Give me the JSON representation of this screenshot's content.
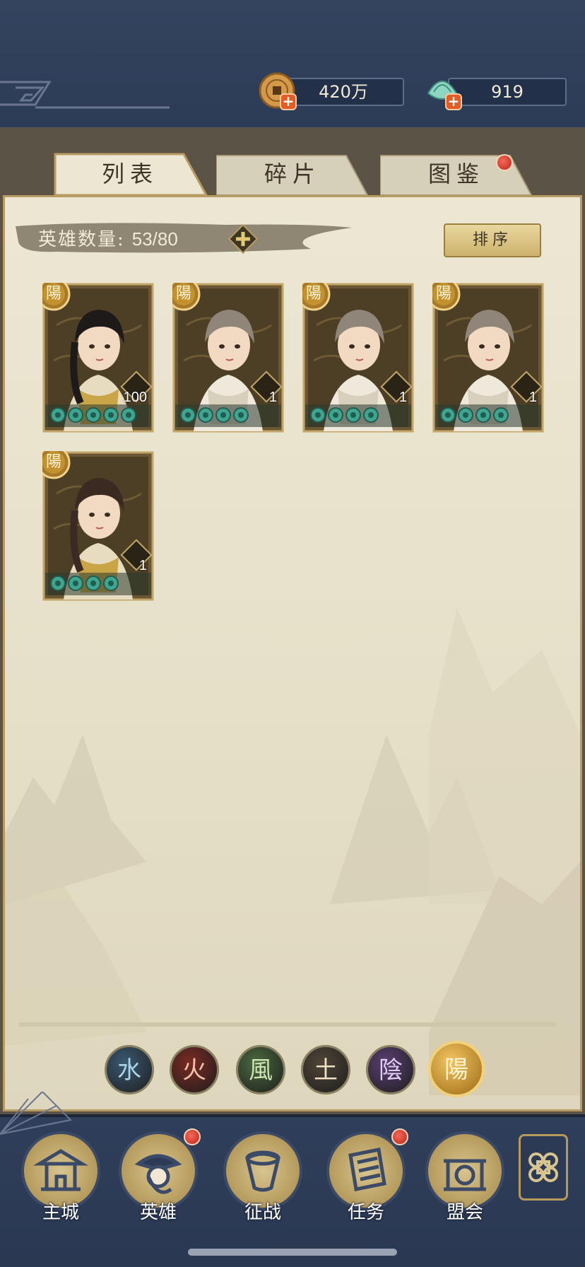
{
  "currencies": [
    {
      "icon": "copper-coin-icon",
      "value": "420万"
    },
    {
      "icon": "jade-shell-icon",
      "value": "919"
    }
  ],
  "tabs": [
    {
      "label": "列表",
      "active": true
    },
    {
      "label": "碎片",
      "active": false
    },
    {
      "label": "图鉴",
      "active": false,
      "badge": true
    }
  ],
  "hero_count": {
    "label": "英雄数量:",
    "value": "53/80"
  },
  "sort_button": {
    "label": "排序"
  },
  "heroes": [
    {
      "element_badge": "陽",
      "portrait": "female-hero-fan",
      "level": "100",
      "stars": 5
    },
    {
      "element_badge": "陽",
      "portrait": "male-hero-white-robe",
      "level": "1",
      "stars": 4
    },
    {
      "element_badge": "陽",
      "portrait": "male-hero-white-robe",
      "level": "1",
      "stars": 4
    },
    {
      "element_badge": "陽",
      "portrait": "male-hero-white-robe",
      "level": "1",
      "stars": 4
    },
    {
      "element_badge": "陽",
      "portrait": "female-hero-dark-hair",
      "level": "1",
      "stars": 4
    }
  ],
  "element_filters": [
    {
      "glyph": "水",
      "color": "#3a5873",
      "text_color": "#a8d4e3",
      "active": false
    },
    {
      "glyph": "火",
      "color": "#7a2a22",
      "text_color": "#f2c2a8",
      "active": false
    },
    {
      "glyph": "風",
      "color": "#4a6a3e",
      "text_color": "#cfe3b2",
      "active": false
    },
    {
      "glyph": "土",
      "color": "#4f4537",
      "text_color": "#f0e2c2",
      "active": false
    },
    {
      "glyph": "陰",
      "color": "#5a3e72",
      "text_color": "#e2cdf2",
      "active": false
    },
    {
      "glyph": "陽",
      "color": "#c99a2e",
      "text_color": "#fff4d1",
      "active": true
    }
  ],
  "nav": [
    {
      "label": "主城",
      "icon": "castle-icon",
      "badge": false
    },
    {
      "label": "英雄",
      "icon": "hero-portrait-icon",
      "badge": true,
      "active": true
    },
    {
      "label": "征战",
      "icon": "horn-icon",
      "badge": false
    },
    {
      "label": "任务",
      "icon": "scroll-task-icon",
      "badge": true
    },
    {
      "label": "盟会",
      "icon": "alliance-gate-icon",
      "badge": false
    }
  ],
  "colors": {
    "header_bg": "#2c3b56",
    "panel_bg": "#e6e0c9",
    "gold_border": "#b79b62",
    "badge_red": "#c02318"
  }
}
